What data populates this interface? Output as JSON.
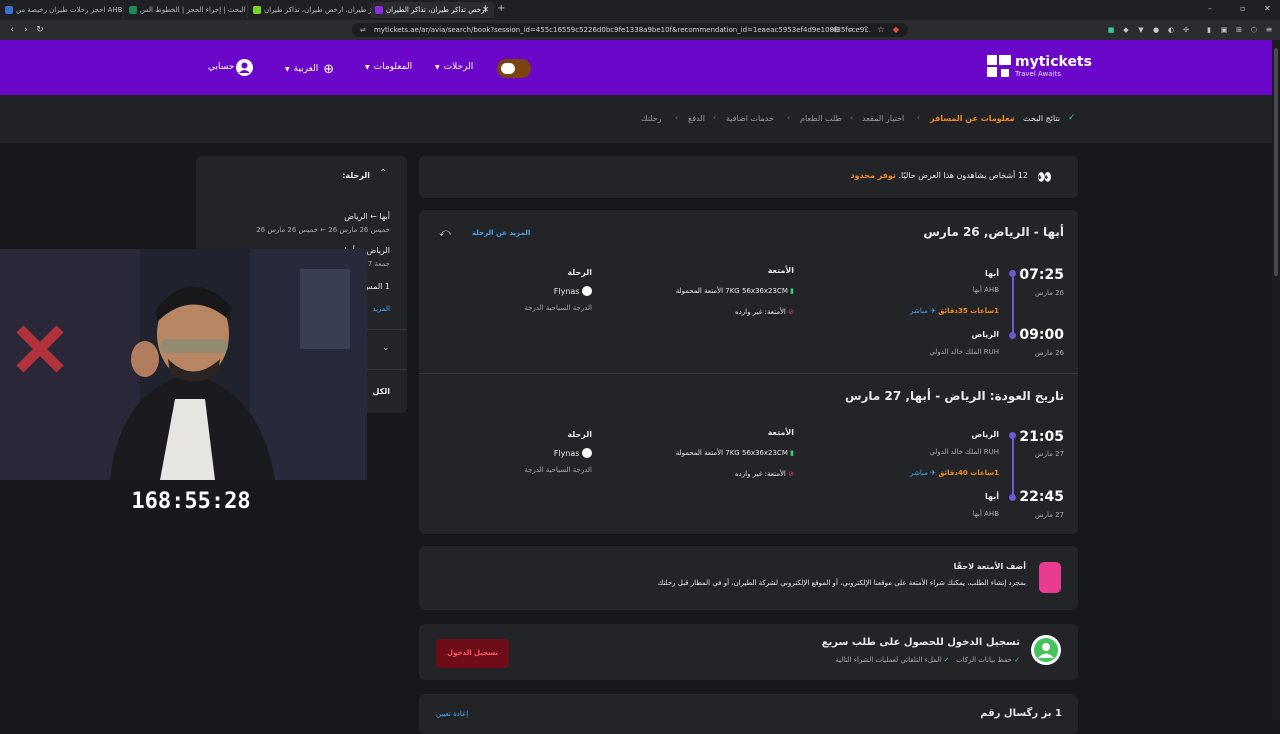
{
  "browser": {
    "tabs": [
      {
        "label": "احجز رحلات طيران رخيصة من AHB الى"
      },
      {
        "label": "نتائج البحث | إجراء الحجز | الخطوط الس..."
      },
      {
        "label": "نتائج البحث | إجراء الحجز | الخطوط الس..."
      },
      {
        "label": "حجز طيران، ارخص طيران، تذاكر طيران |"
      },
      {
        "label": "أرخص تذاكر طيران، تذاكر الطيران"
      }
    ],
    "url": "mytickets.ae/ar/avia/search/book?session_id=455c16559c5226d0bc9fe1338a9be10f&recommendation_id=1eaeac5953ef4d9e108f35fcce9..."
  },
  "header": {
    "logo_name": "mytickets",
    "logo_tagline": "Travel Awaits",
    "nav_trips": "الرحلات",
    "nav_info": "المعلومات",
    "nav_lang": "العربية",
    "nav_account": "حسابي"
  },
  "steps": [
    "نتائج البحث",
    "معلومات عن المسافر",
    "اختيار المقعد",
    "طلب الطعام",
    "خدمات اضافية",
    "الدفع",
    "رحلتك"
  ],
  "notice": {
    "count": "12",
    "text": "أشخاص يشاهدون هذا العرض حاليًا.",
    "limited": "توفر محدود"
  },
  "outbound": {
    "title": "أبها - الرياض, 26 مارس",
    "more": "المزيد عن الرحلة",
    "dep_time": "07:25",
    "dep_date": "26 مارس",
    "dep_city": "أبها",
    "dep_airport": "AHB أبها",
    "duration": "1ساعات 35دقائق",
    "direct": "مباشر",
    "arr_time": "09:00",
    "arr_date": "26 مارس",
    "arr_city": "الرياض",
    "arr_airport": "RUH الملك خالد الدولي",
    "baggage_title": "الأمتعة",
    "carry_on": "7KG 56x36x23CM الأمتعة المحمولة",
    "checked": "الأمتعة: غير وارده",
    "flight_title": "الرحلة",
    "airline": "Flynas",
    "cabin": "الدرجة السياحية الدرجة"
  },
  "return": {
    "title": "تاريخ العودة: الرياض - أبها, 27 مارس",
    "dep_time": "21:05",
    "dep_date": "27 مارس",
    "dep_city": "الرياض",
    "dep_airport": "RUH الملك خالد الدولي",
    "duration": "1ساعات 40دقائق",
    "direct": "مباشر",
    "arr_time": "22:45",
    "arr_date": "27 مارس",
    "arr_city": "أبها",
    "arr_airport": "AHB أبها",
    "baggage_title": "الأمتعة",
    "carry_on": "7KG 56x36x23CM الأمتعة المحمولة",
    "checked": "الأمتعة: غير وارده",
    "flight_title": "الرحلة",
    "airline": "Flynas",
    "cabin": "الدرجة السياحية الدرجة"
  },
  "baggage_card": {
    "title": "أضف الأمتعة لاحقًا",
    "text": "بمجرد إنشاء الطلب، يمكنك شراء الأمتعة على موقعنا الإلكتروني، أو الموقع الإلكتروني لشركة الطيران، أو في المطار قبل رحلتك"
  },
  "checkin_card": {
    "title": "تسجيل الدخول للحصول على طلب سريع",
    "feat1": "حفظ بيانات الركاب",
    "feat2": "الملء التلقائي لعمليات الشراء التالية",
    "button": "تسجيل الدخول"
  },
  "passenger_card": {
    "title": "1 بز رگسال رقم",
    "reset": "إعادة تعيين"
  },
  "sidebar": {
    "heading": "الرحلة:",
    "route1": "أبها ← الرياض",
    "dates1": "خميس 26 مارس 26 ← خميس 26 مارس 26",
    "route2": "الرياض ← أبها",
    "dates2": "جمعة 27",
    "passengers": "1 المس",
    "more": "المزيد",
    "total": "الكل"
  },
  "stream": {
    "timer": "168:55:28"
  },
  "colors": {
    "brand": "#6b07c9",
    "accent": "#f08a24",
    "login": "#6e0d17"
  }
}
